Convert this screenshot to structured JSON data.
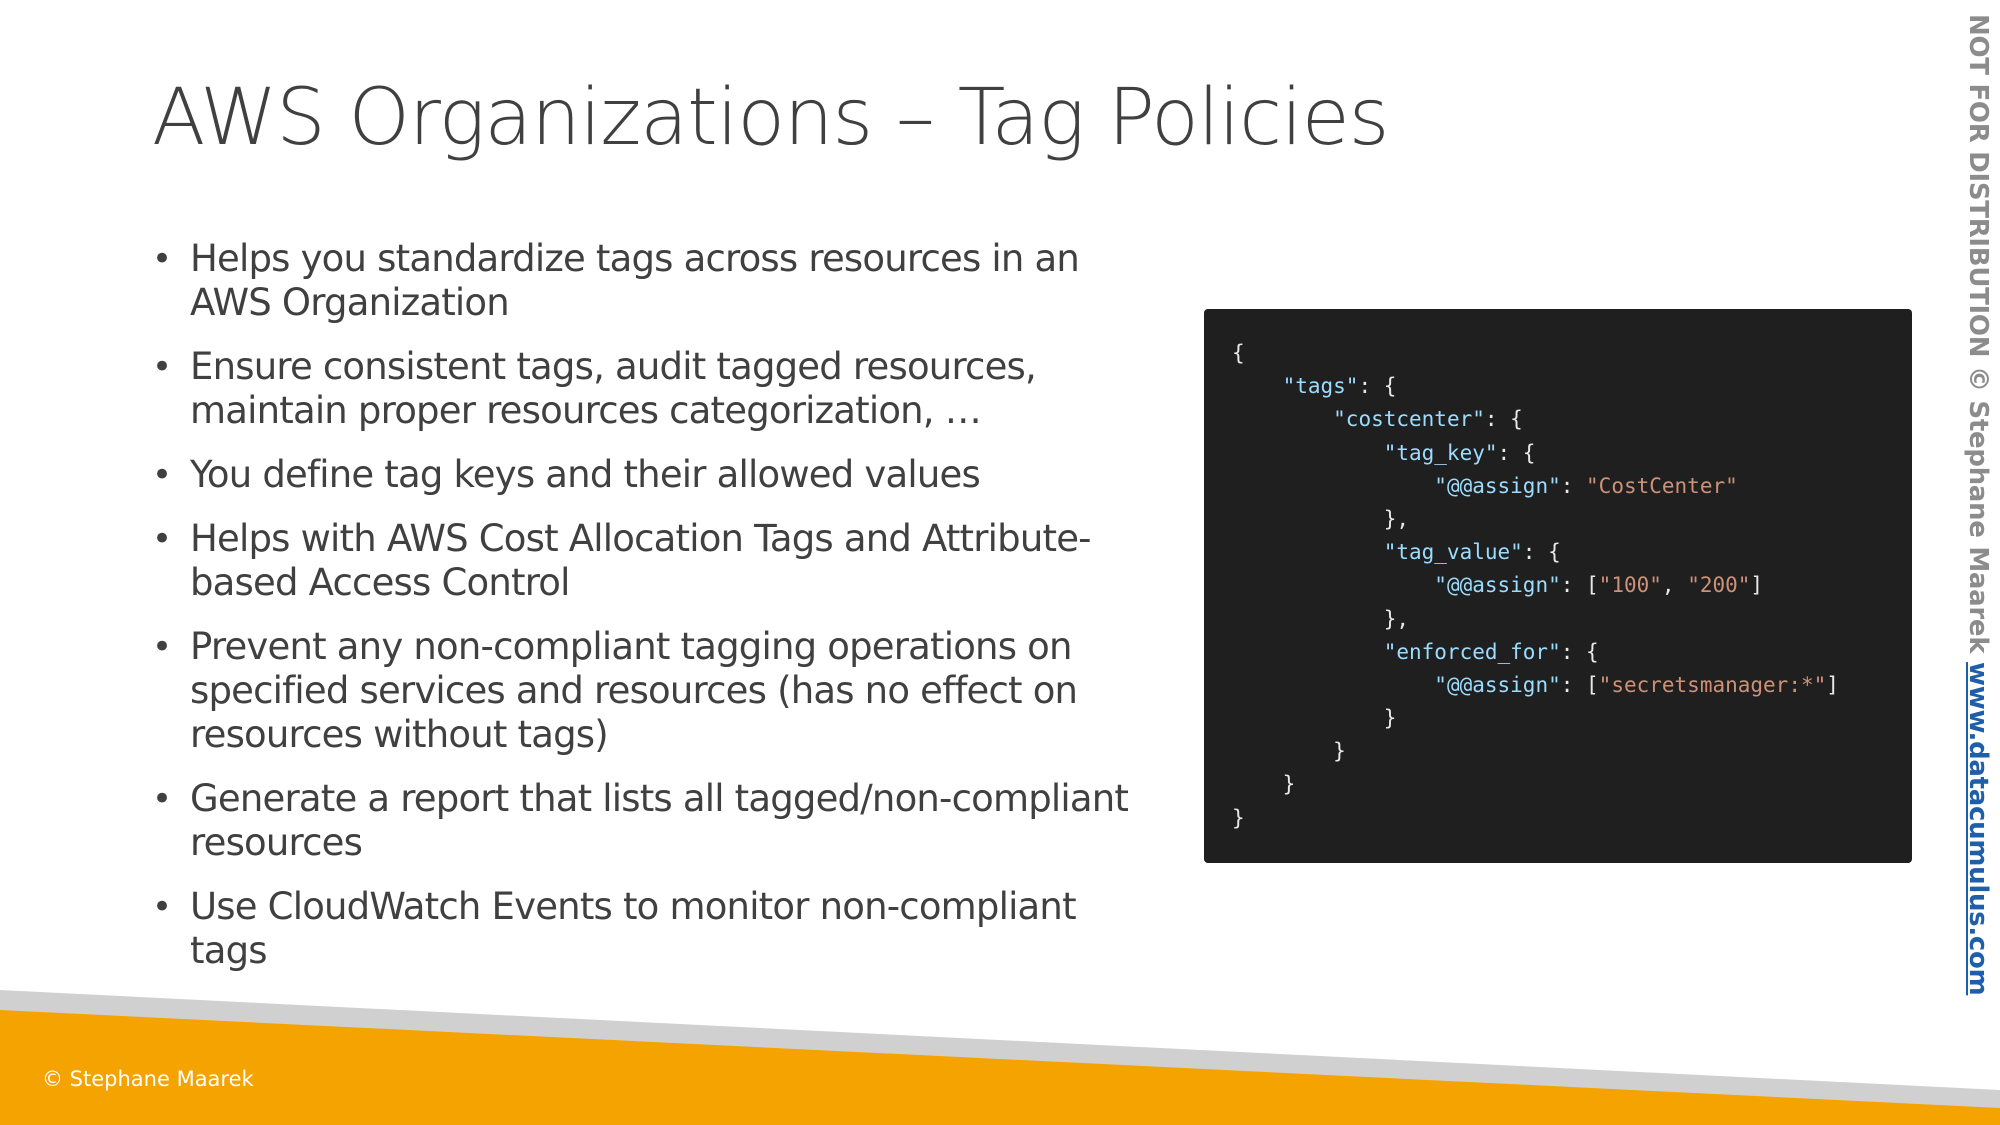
{
  "slide": {
    "title": "AWS Organizations – Tag Policies",
    "bullet_symbol": "•",
    "bullets": [
      {
        "lines": [
          "Helps you standardize tags across resources in an",
          "AWS Organization"
        ]
      },
      {
        "lines": [
          "Ensure consistent tags, audit tagged resources,",
          "maintain proper resources categorization, …"
        ]
      },
      {
        "lines": [
          "You define tag keys and their allowed values"
        ]
      },
      {
        "lines": [
          "Helps with AWS Cost Allocation Tags and Attribute-",
          "based Access Control"
        ]
      },
      {
        "lines": [
          "Prevent any non-compliant tagging operations on",
          "specified services and resources (has no effect on",
          "resources without tags)"
        ]
      },
      {
        "lines": [
          "Generate a report that lists all tagged/non-compliant",
          "resources"
        ]
      },
      {
        "lines": [
          "Use CloudWatch Events to monitor non-compliant",
          "tags"
        ]
      }
    ]
  },
  "code_block": {
    "lines": [
      [
        {
          "t": "{",
          "k": "punct"
        }
      ],
      [
        {
          "t": "    ",
          "k": "ws"
        },
        {
          "t": "\"tags\"",
          "k": "key"
        },
        {
          "t": ": {",
          "k": "punct"
        }
      ],
      [
        {
          "t": "        ",
          "k": "ws"
        },
        {
          "t": "\"costcenter\"",
          "k": "key"
        },
        {
          "t": ": {",
          "k": "punct"
        }
      ],
      [
        {
          "t": "            ",
          "k": "ws"
        },
        {
          "t": "\"tag_key\"",
          "k": "key"
        },
        {
          "t": ": {",
          "k": "punct"
        }
      ],
      [
        {
          "t": "                ",
          "k": "ws"
        },
        {
          "t": "\"@@assign\"",
          "k": "key"
        },
        {
          "t": ": ",
          "k": "punct"
        },
        {
          "t": "\"CostCenter\"",
          "k": "str"
        }
      ],
      [
        {
          "t": "            ",
          "k": "ws"
        },
        {
          "t": "},",
          "k": "punct"
        }
      ],
      [
        {
          "t": "            ",
          "k": "ws"
        },
        {
          "t": "\"tag_value\"",
          "k": "key"
        },
        {
          "t": ": {",
          "k": "punct"
        }
      ],
      [
        {
          "t": "                ",
          "k": "ws"
        },
        {
          "t": "\"@@assign\"",
          "k": "key"
        },
        {
          "t": ": [",
          "k": "punct"
        },
        {
          "t": "\"100\"",
          "k": "str"
        },
        {
          "t": ", ",
          "k": "punct"
        },
        {
          "t": "\"200\"",
          "k": "str"
        },
        {
          "t": "]",
          "k": "punct"
        }
      ],
      [
        {
          "t": "            ",
          "k": "ws"
        },
        {
          "t": "},",
          "k": "punct"
        }
      ],
      [
        {
          "t": "            ",
          "k": "ws"
        },
        {
          "t": "\"enforced_for\"",
          "k": "key"
        },
        {
          "t": ": {",
          "k": "punct"
        }
      ],
      [
        {
          "t": "                ",
          "k": "ws"
        },
        {
          "t": "\"@@assign\"",
          "k": "key"
        },
        {
          "t": ": [",
          "k": "punct"
        },
        {
          "t": "\"secretsmanager:*\"",
          "k": "str"
        },
        {
          "t": "]",
          "k": "punct"
        }
      ],
      [
        {
          "t": "            ",
          "k": "ws"
        },
        {
          "t": "}",
          "k": "punct"
        }
      ],
      [
        {
          "t": "        ",
          "k": "ws"
        },
        {
          "t": "}",
          "k": "punct"
        }
      ],
      [
        {
          "t": "    ",
          "k": "ws"
        },
        {
          "t": "}",
          "k": "punct"
        }
      ],
      [
        {
          "t": "}",
          "k": "punct"
        }
      ]
    ]
  },
  "sidebar": {
    "watermark": "NOT FOR DISTRIBUTION © Stephane Maarek",
    "site_link": "www.datacumulus.com"
  },
  "footer": {
    "credit": "© Stephane Maarek"
  },
  "colors": {
    "text": "#404040",
    "code_background": "#1f1f1f",
    "code_key": "#9cdcfe",
    "code_string": "#ce9178",
    "code_punct": "#e8e8e8",
    "footer_orange": "#f5a300",
    "footer_gray": "#d0d0d0",
    "watermark_gray": "#8c8c8c",
    "link_blue": "#1f5ea8"
  }
}
